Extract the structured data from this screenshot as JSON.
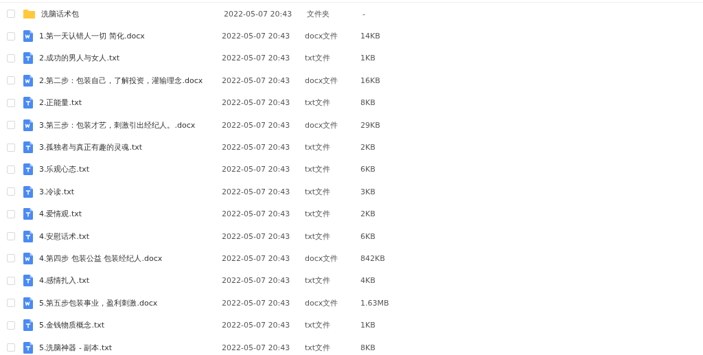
{
  "files": [
    {
      "kind": "folder",
      "name": "洗脑话术包",
      "modified": "2022-05-07 20:43",
      "type": "文件夹",
      "size": "-",
      "checked": false
    },
    {
      "kind": "word",
      "name": "1.第一天认错人一切 简化.docx",
      "modified": "2022-05-07 20:43",
      "type": "docx文件",
      "size": "14KB",
      "checked": false
    },
    {
      "kind": "text",
      "name": "2.成功的男人与女人.txt",
      "modified": "2022-05-07 20:43",
      "type": "txt文件",
      "size": "1KB",
      "checked": false
    },
    {
      "kind": "word",
      "name": "2.第二步：包装自己，了解投资，灌输理念.docx",
      "modified": "2022-05-07 20:43",
      "type": "docx文件",
      "size": "16KB",
      "checked": false
    },
    {
      "kind": "text",
      "name": "2.正能量.txt",
      "modified": "2022-05-07 20:43",
      "type": "txt文件",
      "size": "8KB",
      "checked": false
    },
    {
      "kind": "word",
      "name": "3.第三步：包装才艺，刺激引出经纪人。.docx",
      "modified": "2022-05-07 20:43",
      "type": "docx文件",
      "size": "29KB",
      "checked": false
    },
    {
      "kind": "text",
      "name": "3.孤独者与真正有趣的灵魂.txt",
      "modified": "2022-05-07 20:43",
      "type": "txt文件",
      "size": "2KB",
      "checked": false
    },
    {
      "kind": "text",
      "name": "3.乐观心态.txt",
      "modified": "2022-05-07 20:43",
      "type": "txt文件",
      "size": "6KB",
      "checked": false
    },
    {
      "kind": "text",
      "name": "3.冷读.txt",
      "modified": "2022-05-07 20:43",
      "type": "txt文件",
      "size": "3KB",
      "checked": false
    },
    {
      "kind": "text",
      "name": "4.爱情观.txt",
      "modified": "2022-05-07 20:43",
      "type": "txt文件",
      "size": "2KB",
      "checked": false
    },
    {
      "kind": "text",
      "name": "4.安慰话术.txt",
      "modified": "2022-05-07 20:43",
      "type": "txt文件",
      "size": "6KB",
      "checked": false
    },
    {
      "kind": "word",
      "name": "4.第四步 包装公益 包装经纪人.docx",
      "modified": "2022-05-07 20:43",
      "type": "docx文件",
      "size": "842KB",
      "checked": false
    },
    {
      "kind": "text",
      "name": "4.感情扎入.txt",
      "modified": "2022-05-07 20:43",
      "type": "txt文件",
      "size": "4KB",
      "checked": false
    },
    {
      "kind": "word",
      "name": "5.第五步包装事业，盈利刺激.docx",
      "modified": "2022-05-07 20:43",
      "type": "docx文件",
      "size": "1.63MB",
      "checked": false
    },
    {
      "kind": "text",
      "name": "5.金钱物质概念.txt",
      "modified": "2022-05-07 20:43",
      "type": "txt文件",
      "size": "1KB",
      "checked": false
    },
    {
      "kind": "text",
      "name": "5.洗脑神器 - 副本.txt",
      "modified": "2022-05-07 20:43",
      "type": "txt文件",
      "size": "8KB",
      "checked": false
    }
  ]
}
